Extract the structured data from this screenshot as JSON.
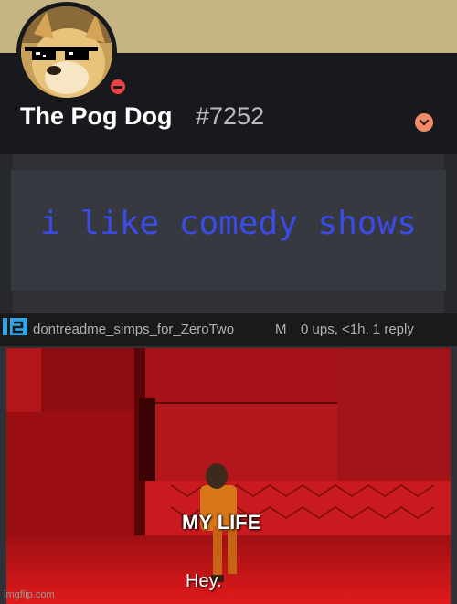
{
  "profile": {
    "username": "The Pog Dog",
    "discriminator": "#7252",
    "status": "do-not-disturb",
    "bio": "i like comedy shows",
    "avatar_icon": "doge-with-sunglasses-icon",
    "chevron_icon": "chevron-down-icon"
  },
  "reply": {
    "username": "dontreadme_simps_for_ZeroTwo",
    "flair": "M",
    "meta": "0 ups, <1h, 1 reply"
  },
  "meme": {
    "label": "MY LIFE",
    "caption": "Hey."
  },
  "watermark": "imgflip.com",
  "colors": {
    "banner": "#c6b482",
    "profile_bg": "#18191c",
    "bio_text": "#3b4be8",
    "status_dnd": "#ed4245",
    "meme_red": "#b5121b"
  }
}
